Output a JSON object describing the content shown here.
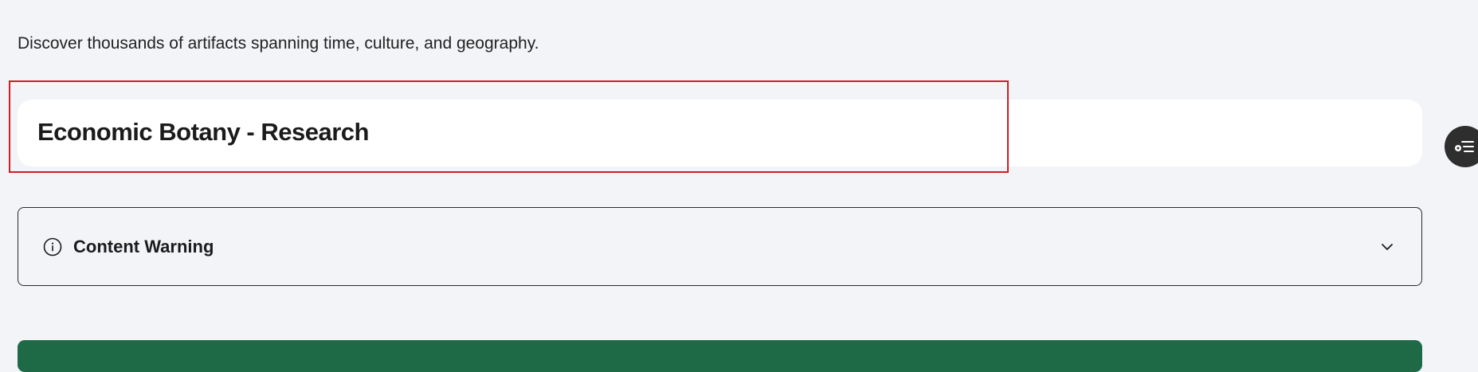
{
  "intro": {
    "text": "Discover thousands of artifacts spanning time, culture, and geography."
  },
  "title_card": {
    "title": "Economic Botany - Research"
  },
  "content_warning": {
    "label": "Content Warning",
    "icon": "info-circle-icon",
    "toggle_icon": "chevron-down-icon",
    "expanded": false
  },
  "floating_button": {
    "icon": "list-settings-icon"
  },
  "colors": {
    "background": "#f3f4f8",
    "highlight": "#d71920",
    "primary_bar": "#1e6a46",
    "floating_button": "#2e2e2e"
  }
}
